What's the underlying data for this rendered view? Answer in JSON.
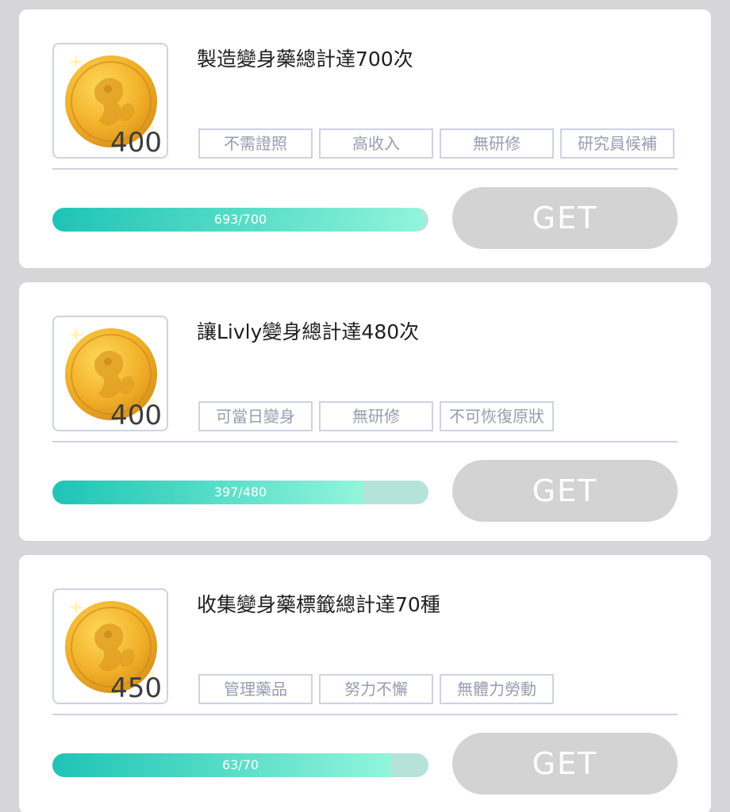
{
  "missions": [
    {
      "title": "製造變身藥總計達700次",
      "reward": "400",
      "tags": [
        "不需證照",
        "高收入",
        "無研修",
        "研究員候補"
      ],
      "progress_text": "693/700",
      "progress_fraction": 0.99,
      "button_label": "GET"
    },
    {
      "title": "讓Livly變身總計達480次",
      "reward": "400",
      "tags": [
        "可當日變身",
        "無研修",
        "不可恢復原狀"
      ],
      "progress_text": "397/480",
      "progress_fraction": 0.827,
      "button_label": "GET"
    },
    {
      "title": "收集變身藥標籤總計達70種",
      "reward": "450",
      "tags": [
        "管理藥品",
        "努力不懈",
        "無體力勞動"
      ],
      "progress_text": "63/70",
      "progress_fraction": 0.9,
      "button_label": "GET"
    }
  ],
  "colors": {
    "progress_start": "#1ec4b6",
    "progress_end": "#92f5dc",
    "button_disabled": "#d3d3d3",
    "coin_gold": "#f0b429"
  },
  "icons": {
    "reward": "gold-coin-icon"
  }
}
